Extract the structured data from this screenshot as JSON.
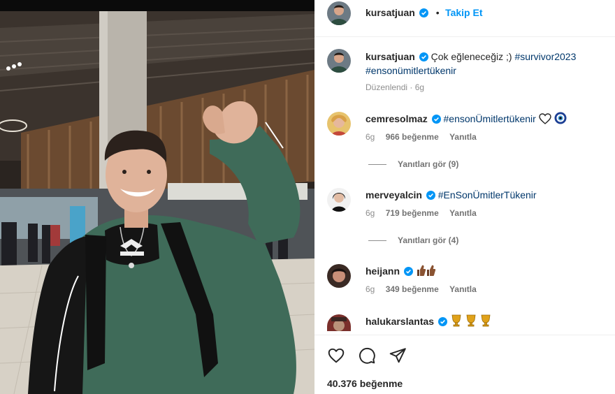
{
  "post": {
    "author": "kursatjuan",
    "follow_label": "Takip Et",
    "separator": "•",
    "caption_prefix": "Çok eğleneceğiz ;)",
    "caption_tags": [
      "#survivor2023",
      "#ensonümitlertükenir"
    ],
    "edited_meta": "Düzenlendi · 6g",
    "likes_total": "40.376 beğenme"
  },
  "comments": [
    {
      "username": "cemresolmaz",
      "text": "#ensonÜmitlertükenir",
      "time": "6g",
      "likes": "966 beğenme",
      "reply_label": "Yanıtla",
      "view_replies": "Yanıtları gör (9)",
      "emojis": [
        "white-heart",
        "nazar-amulet"
      ]
    },
    {
      "username": "merveyalcin",
      "text": "#EnSonÜmitlerTükenir",
      "time": "6g",
      "likes": "719 beğenme",
      "reply_label": "Yanıtla",
      "view_replies": "Yanıtları gör (4)",
      "emojis": []
    },
    {
      "username": "heijann",
      "text": "",
      "time": "6g",
      "likes": "349 beğenme",
      "reply_label": "Yanıtla",
      "emojis": [
        "thumbs-up",
        "thumbs-up"
      ]
    },
    {
      "username": "halukarslantas",
      "text": "",
      "emojis": [
        "trophy",
        "trophy",
        "trophy"
      ]
    }
  ],
  "colors": {
    "link_blue": "#0095f6",
    "hashtag_blue": "#00376b",
    "verified_blue": "#0095f6",
    "muted_gray": "#8e8e8e",
    "sweater_green": "#3f6b59"
  },
  "icons": [
    "verified-badge-icon",
    "heart-icon",
    "comment-icon",
    "share-icon"
  ]
}
